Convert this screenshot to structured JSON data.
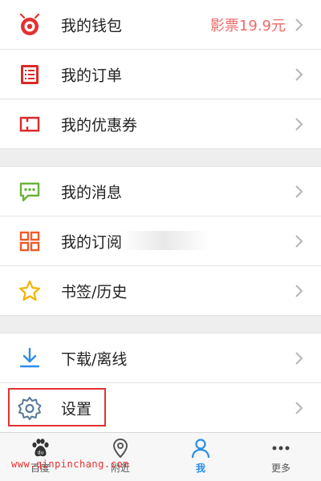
{
  "menu": {
    "wallet": {
      "label": "我的钱包",
      "extra": "影票19.9元",
      "icon": "wallet-icon"
    },
    "orders": {
      "label": "我的订单",
      "icon": "order-list-icon"
    },
    "coupons": {
      "label": "我的优惠券",
      "icon": "coupon-icon"
    },
    "messages": {
      "label": "我的消息",
      "icon": "message-icon"
    },
    "subscriptions": {
      "label": "我的订阅",
      "icon": "grid-icon"
    },
    "bookmarks": {
      "label": "书签/历史",
      "icon": "star-icon"
    },
    "downloads": {
      "label": "下载/离线",
      "icon": "download-icon"
    },
    "settings": {
      "label": "设置",
      "icon": "gear-icon"
    }
  },
  "tabbar": {
    "tabs": [
      {
        "label": "百度",
        "icon": "baidu-paw-icon"
      },
      {
        "label": "附近",
        "icon": "location-pin-icon"
      },
      {
        "label": "我",
        "icon": "person-icon",
        "active": true
      },
      {
        "label": "更多",
        "icon": "more-dots-icon"
      }
    ]
  },
  "watermark": "www.qinpinchang.com",
  "colors": {
    "accent_blue": "#2a8ee8",
    "red_icon": "#e53030",
    "price_text": "#f06a6a",
    "green_icon": "#6ab23a",
    "orange_icon": "#f05a28",
    "yellow_icon": "#f5b301",
    "gear_gray": "#5a7a9a"
  }
}
